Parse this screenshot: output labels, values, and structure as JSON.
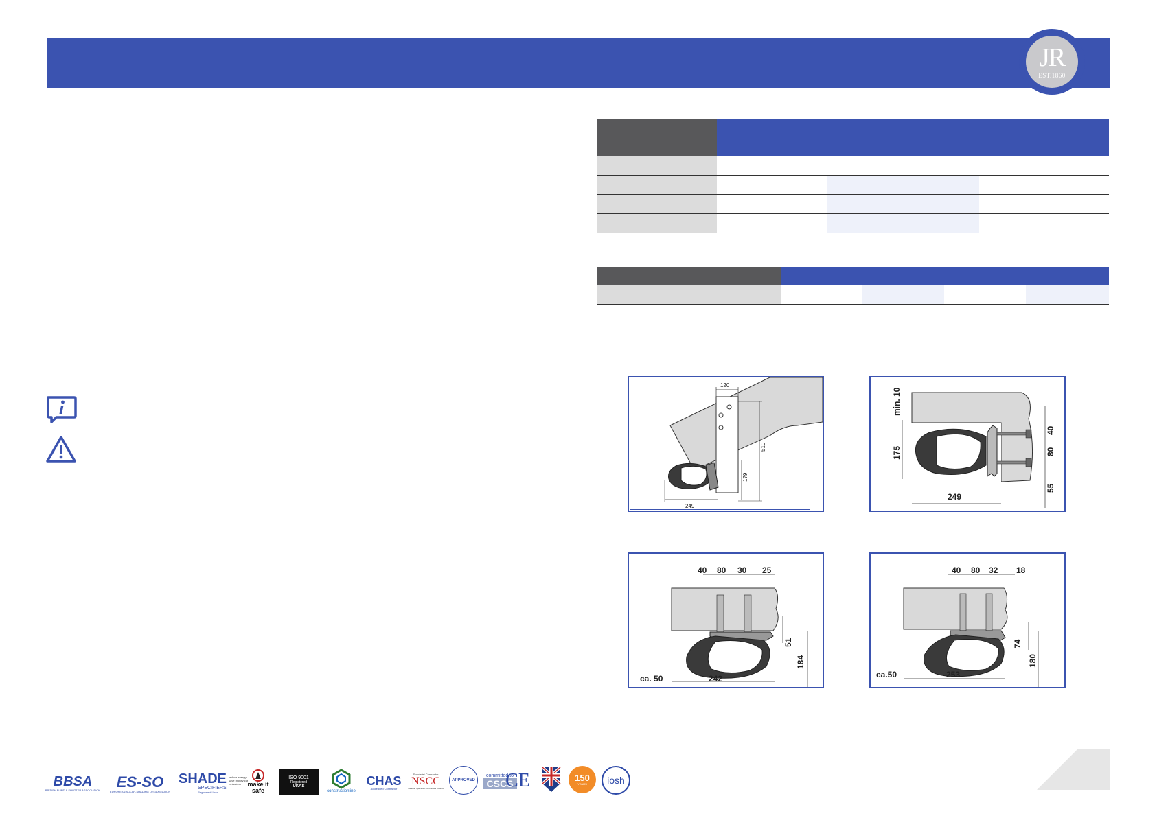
{
  "logo": {
    "monogram": "JR",
    "est": "EST.1860"
  },
  "tables": {
    "spec1": {
      "rows": 4
    },
    "spec2": {
      "rows": 1
    }
  },
  "diagrams": {
    "d1": {
      "dims": {
        "a": "120",
        "b": "510",
        "c": "179",
        "d": "249"
      }
    },
    "d2": {
      "dims": {
        "a": "min. 10",
        "b": "175",
        "c": "40",
        "d": "80",
        "e": "55",
        "f": "249"
      }
    },
    "d3": {
      "dims": {
        "a": "40",
        "b": "80",
        "c": "30",
        "d": "25",
        "e": "51",
        "f": "184",
        "g": "ca. 50",
        "h": "242"
      }
    },
    "d4": {
      "dims": {
        "a": "40",
        "b": "80",
        "c": "32",
        "d": "18",
        "e": "74",
        "f": "180",
        "g": "ca.50",
        "h": "253"
      }
    }
  },
  "footer_logos": {
    "bbsa": "BBSA",
    "bbsa_sub": "BRITISH BLIND & SHUTTER ASSOCIATION",
    "es_so": "ES-SO",
    "es_so_sub": "EUROPEAN SOLAR-SHADING ORGANIZATION",
    "shade": "SHADE",
    "shade_sub": "SPECIFIERS",
    "shade_tag": "reduce energy save money cut emissions",
    "shade_reg": "Registered User",
    "make_it_safe": "make it safe",
    "iso": "ISO 9001",
    "iso_sub": "Registered",
    "ukas": "UKAS",
    "constructionline": "constructionline",
    "chas": "CHAS",
    "chas_sub": "Accredited Contractor",
    "nscc_top": "Specialist Contractor",
    "nscc": "NSCC",
    "nscc_sub": "National Specialist Contractors Council",
    "approved": "APPROVED",
    "cscs_top": "committed to",
    "cscs": "CSCS",
    "ce": "CE",
    "anniv": "150",
    "anniv_sub": "YEARS",
    "iosh": "iosh"
  },
  "colors": {
    "brand_blue": "#3b53b0",
    "dark_grey": "#58585a",
    "light_grey": "#dcdcdc"
  }
}
